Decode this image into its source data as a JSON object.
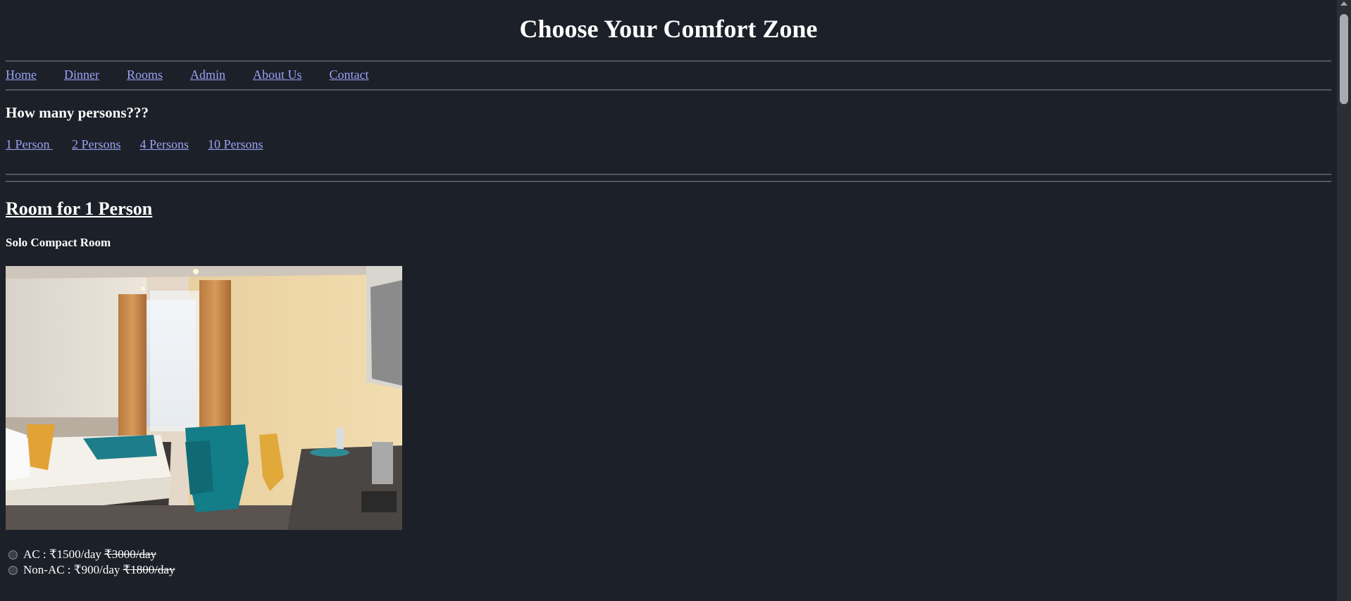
{
  "header": {
    "title": "Choose Your Comfort Zone"
  },
  "nav": {
    "items": [
      {
        "label": "Home"
      },
      {
        "label": "Dinner"
      },
      {
        "label": "Rooms"
      },
      {
        "label": "Admin"
      },
      {
        "label": "About Us"
      },
      {
        "label": "Contact"
      }
    ]
  },
  "persons": {
    "question": "How many persons???",
    "options": [
      {
        "label": "1 Person "
      },
      {
        "label": "2 Persons"
      },
      {
        "label": "4 Persons"
      },
      {
        "label": "10 Persons"
      }
    ]
  },
  "room": {
    "heading": "Room for 1 Person",
    "name": "Solo Compact Room",
    "photo_icon": "hotel-room-photo",
    "pricing": [
      {
        "label": "AC : ₹1500/day",
        "original": "₹3000/day"
      },
      {
        "label": "Non-AC : ₹900/day",
        "original": "₹1800/day"
      }
    ]
  },
  "colors": {
    "background": "#1c2028",
    "link": "#9aa3f5",
    "text": "#ffffff"
  }
}
